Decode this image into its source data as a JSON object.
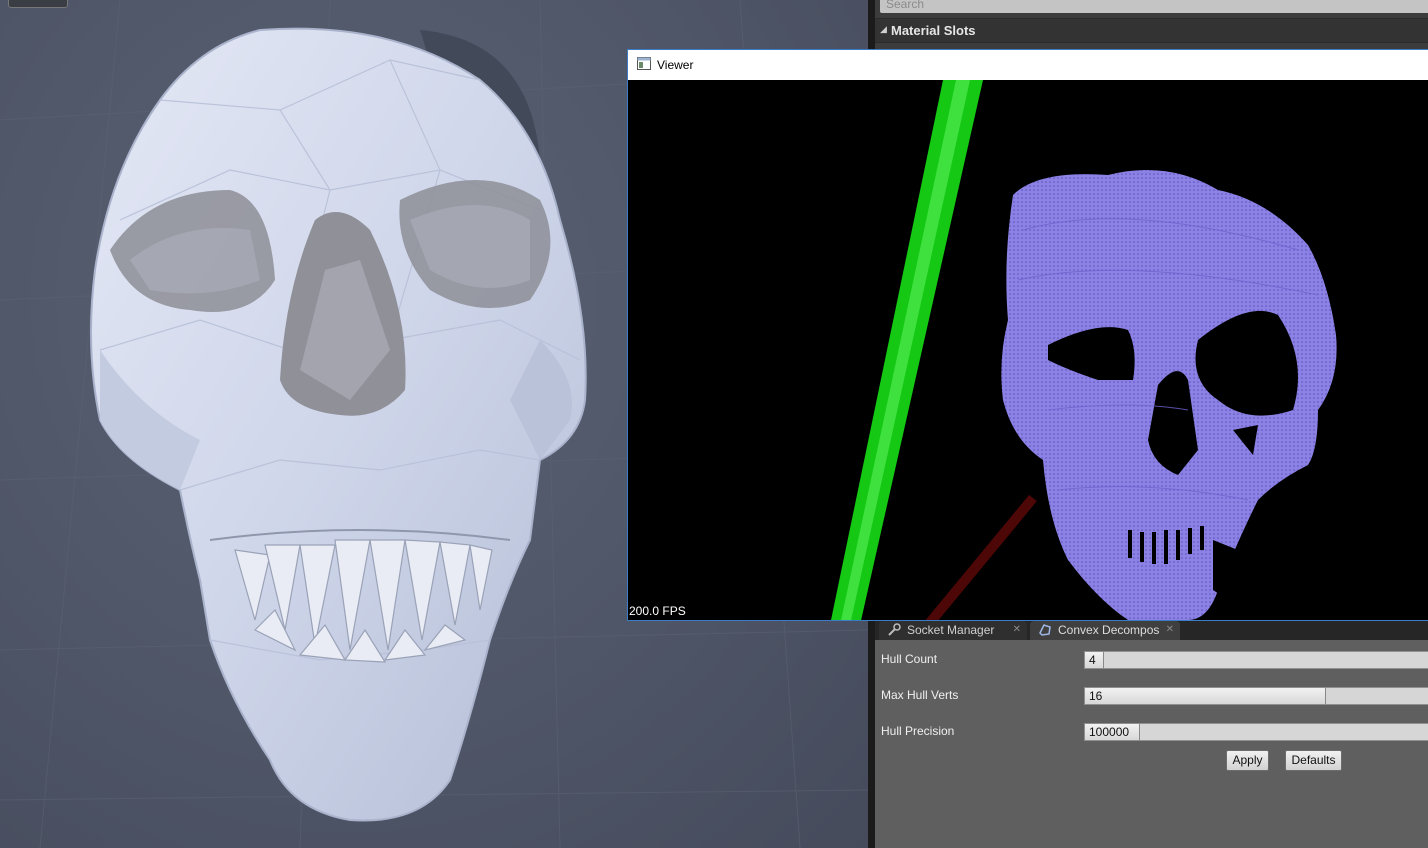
{
  "viewport": {
    "name": "Static mesh viewport"
  },
  "details": {
    "search_placeholder": "Search",
    "material_slots_title": "Material Slots"
  },
  "viewer": {
    "title": "Viewer",
    "fps": "200.0 FPS",
    "pointcloud_color": "#8c82e6",
    "axis_green": "#19d419",
    "axis_red": "#5a0a0a"
  },
  "tabs": [
    {
      "label": "Socket Manager",
      "icon": "socket-icon"
    },
    {
      "label": "Convex Decompos",
      "icon": "convex-icon"
    }
  ],
  "convex": {
    "hull_count": {
      "label": "Hull Count",
      "value": "4",
      "fraction": 0.05
    },
    "max_hull_verts": {
      "label": "Max Hull Verts",
      "value": "16",
      "fraction": 0.67
    },
    "hull_precision": {
      "label": "Hull Precision",
      "value": "100000",
      "fraction": 0.15
    },
    "apply_label": "Apply",
    "defaults_label": "Defaults"
  }
}
